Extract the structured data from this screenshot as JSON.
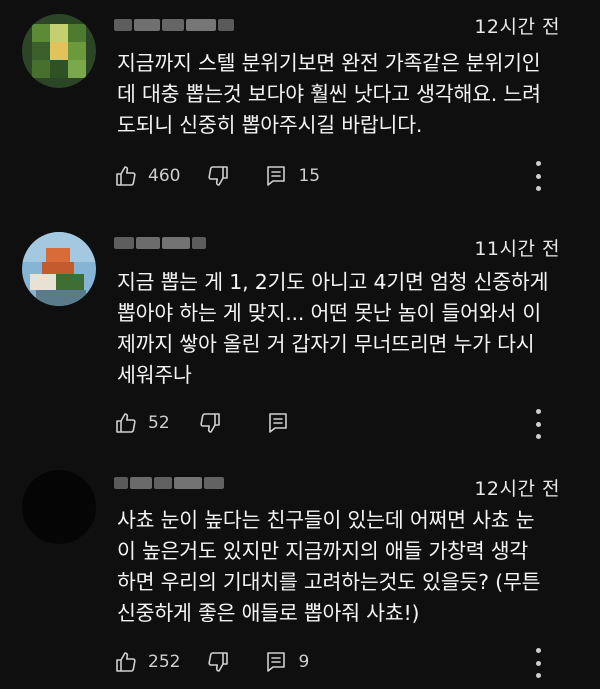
{
  "comments": [
    {
      "timestamp": "12시간 전",
      "text": "지금까지 스텔 분위기보면 완전 가족같은 분위기인\n데 대충 뽑는것 보다야 훨씬 낫다고 생각해요. 느려\n도되니 신중히 뽑아주시길 바랍니다.",
      "likes": "460",
      "replies": "15",
      "avatar_colors": [
        "#2f4a2a",
        "#7fae3f",
        "#3c6b2c",
        "#c0d070"
      ]
    },
    {
      "timestamp": "11시간 전",
      "text": "지금 뽑는 게 1, 2기도 아니고 4기면 엄청 신중하게\n뽑아야 하는 게 맞지... 어떤 못난 놈이 들어와서 이\n제까지 쌓아 올린 거 갑자기 무너뜨리면 누가 다시\n세워주나",
      "likes": "52",
      "replies": "",
      "avatar_colors": [
        "#8ab8d8",
        "#d06a3a",
        "#4a7a3a",
        "#e8e0d0"
      ]
    },
    {
      "timestamp": "12시간 전",
      "text": "사쵸 눈이 높다는 친구들이 있는데 어쩌면 사쵸 눈\n이 높은거도 있지만 지금까지의 애들 가창력 생각\n하면 우리의 기대치를 고려하는것도 있을듯? (무튼\n신중하게 좋은 애들로 뽑아줘 사쵸!)",
      "likes": "252",
      "replies": "9",
      "avatar_colors": [
        "#050505"
      ]
    }
  ]
}
